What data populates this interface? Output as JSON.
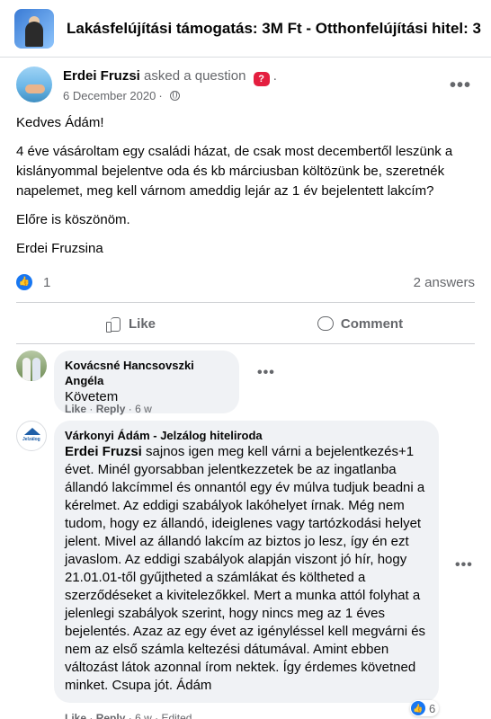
{
  "group": {
    "title": "Lakásfelújítási támogatás: 3M Ft - Otthonfelújítási hitel: 3"
  },
  "post": {
    "author": "Erdei Fruzsi",
    "action": "asked a question",
    "date": "6 December 2020",
    "paragraphs": [
      "Kedves Ádám!",
      "4 éve vásároltam egy családi házat, de csak most decembertől leszünk a kislányommal bejelentve oda és kb márciusban költözünk be, szeretnék napelemet, meg kell várnom ameddig lejár az 1 év bejelentett lakcím?",
      "Előre is köszönöm.",
      "Erdei Fruzsina"
    ],
    "likes": "1",
    "answers": "2 answers",
    "like_label": "Like",
    "comment_label": "Comment"
  },
  "comments": [
    {
      "author": "Kovácsné Hancsovszki Angéla",
      "text": "Követem",
      "like_label": "Like",
      "reply_label": "Reply",
      "time": "6 w"
    },
    {
      "author": "Várkonyi Ádám - Jelzálog hiteliroda",
      "tag": "Erdei Fruzsi",
      "text": " sajnos igen meg kell várni a bejelentkezés+1 évet. Minél gyorsabban jelentkezzetek be az ingatlanba állandó lakcímmel és onnantól egy év múlva tudjuk beadni a kérelmet. Az eddigi szabályok lakóhelyet írnak. Még nem tudom, hogy ez állandó, ideiglenes vagy tartózkodási helyet jelent. Mivel az állandó lakcím az biztos jo lesz, így én ezt javaslom. Az eddigi szabályok alapján viszont jó hír, hogy 21.01.01-től gyűjtheted a számlákat és költheted a szerződéseket a kivitelezőkkel. Mert a munka attól folyhat a jelenlegi szabályok szerint, hogy nincs meg az 1 éves bejelentés. Azaz az egy évet az igényléssel kell megvárni és nem az első számla keltezési dátumával. Amint ebben változást látok azonnal írom nektek. Így érdemes követned minket. Csupa jót. Ádám",
      "like_label": "Like",
      "reply_label": "Reply",
      "time": "6 w",
      "edited": "Edited",
      "reactions": "6",
      "avatar_text": "Jelzálog"
    }
  ]
}
